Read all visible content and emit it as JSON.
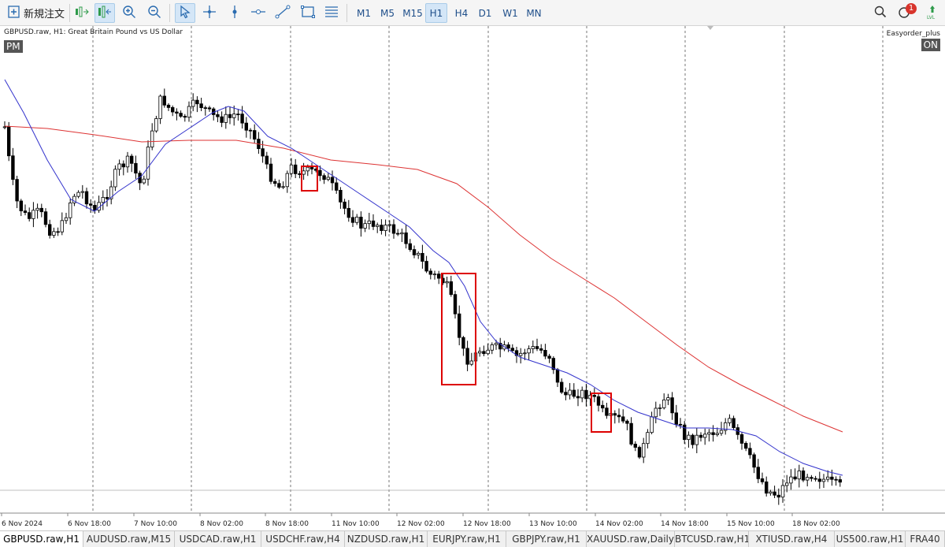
{
  "toolbar": {
    "new_order_label": "新規注文",
    "timeframes": [
      "M1",
      "M5",
      "M15",
      "H1",
      "H4",
      "D1",
      "W1",
      "MN"
    ],
    "active_timeframe": "H1",
    "notification_count": "1",
    "icons": [
      "new-order-icon",
      "chart-shift-icon",
      "auto-scroll-icon",
      "zoom-in-icon",
      "zoom-out-icon",
      "cursor-icon",
      "crosshair-icon",
      "vertical-line-icon",
      "horizontal-line-icon",
      "trend-line-icon",
      "shapes-icon",
      "fibonacci-icon",
      "search-icon",
      "notification-icon",
      "level-icon"
    ],
    "accent_color": "#2b6cb0"
  },
  "chart": {
    "title": "GBPUSD.raw, H1:  Great Britain Pound vs US Dollar",
    "pm_badge": "PM",
    "ea_name": "Easyorder_plus",
    "on_badge": "ON",
    "x_labels": [
      "6 Nov 2024",
      "6 Nov 18:00",
      "7 Nov 10:00",
      "8 Nov 02:00",
      "8 Nov 18:00",
      "11 Nov 10:00",
      "12 Nov 02:00",
      "12 Nov 18:00",
      "13 Nov 10:00",
      "14 Nov 02:00",
      "14 Nov 18:00",
      "15 Nov 10:00",
      "18 Nov 02:00"
    ]
  },
  "chart_data": {
    "type": "candlestick",
    "symbol": "GBPUSD.raw",
    "timeframe": "H1",
    "x_labels": [
      "6 Nov 2024",
      "6 Nov 18:00",
      "7 Nov 10:00",
      "8 Nov 02:00",
      "8 Nov 18:00",
      "11 Nov 10:00",
      "12 Nov 02:00",
      "12 Nov 18:00",
      "13 Nov 10:00",
      "14 Nov 02:00",
      "14 Nov 18:00",
      "15 Nov 10:00",
      "18 Nov 02:00"
    ],
    "period_separators": true,
    "series": [
      {
        "color": "#3333cc",
        "kind": "fast moving average"
      },
      {
        "color": "#dd3333",
        "kind": "slow moving average"
      }
    ],
    "highlight_boxes": 3,
    "highlight_color": "#dd0000"
  },
  "tabs": [
    {
      "label": "GBPUSD.raw,H1",
      "active": true
    },
    {
      "label": "AUDUSD.raw,M15",
      "active": false
    },
    {
      "label": "USDCAD.raw,H1",
      "active": false
    },
    {
      "label": "USDCHF.raw,H4",
      "active": false
    },
    {
      "label": "NZDUSD.raw,H1",
      "active": false
    },
    {
      "label": "EURJPY.raw,H1",
      "active": false
    },
    {
      "label": "GBPJPY.raw,H1",
      "active": false
    },
    {
      "label": "XAUUSD.raw,Daily",
      "active": false
    },
    {
      "label": "BTCUSD.raw,H1",
      "active": false
    },
    {
      "label": "XTIUSD.raw,H4",
      "active": false
    },
    {
      "label": "US500.raw,H1",
      "active": false
    },
    {
      "label": "FRA40",
      "active": false
    }
  ]
}
